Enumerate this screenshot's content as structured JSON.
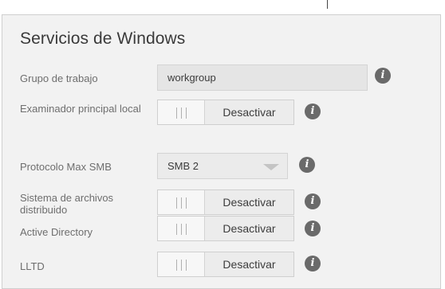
{
  "section": {
    "title": "Servicios de Windows"
  },
  "settings": {
    "workgroup": {
      "label": "Grupo de trabajo",
      "value": "workgroup"
    },
    "local_master_browser": {
      "label": "Examinador principal local",
      "state": "Desactivar"
    },
    "max_smb_protocol": {
      "label": "Protocolo Max SMB",
      "selected": "SMB 2"
    },
    "dfs": {
      "label": "Sistema de archivos distribuido",
      "state": "Desactivar"
    },
    "active_directory": {
      "label": "Active Directory",
      "state": "Desactivar"
    },
    "lltd": {
      "label": "LLTD",
      "state": "Desactivar"
    }
  },
  "info_icon_glyph": "i",
  "colors": {
    "panel_background": "#f2f2f2",
    "info_icon": "#6a6a6a",
    "title_text": "#3a3a3a",
    "label_text": "#6e6e6e"
  }
}
